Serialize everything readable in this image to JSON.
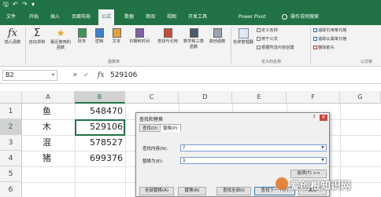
{
  "quick_access": {
    "save": "🖫",
    "undo": "↶",
    "redo": "↷",
    "more": "▾"
  },
  "tabs": [
    "文件",
    "开始",
    "插入",
    "页面布局",
    "公式",
    "数据",
    "审阅",
    "视图",
    "开发工具",
    "Power Pivot"
  ],
  "active_tab": "公式",
  "tell_me": "操作说明搜索",
  "ribbon": {
    "insert_function": "插入函数",
    "autosum": "自动求和",
    "recent": "最近使用的函数",
    "financial": "财务",
    "logical": "逻辑",
    "text": "文本",
    "datetime": "日期和时间",
    "lookup": "查找与引用",
    "math": "数学和三角函数",
    "more_functions": "其他函数",
    "function_library_label": "函数库",
    "name_manager": "名称管理器",
    "define_name": "定义名称",
    "use_in_formula": "用于公式",
    "create_from_selection": "根据所选内容创建",
    "defined_names_label": "定义的名称",
    "trace_precedents": "追踪引用单元格",
    "trace_dependents": "追踪从属单元格",
    "remove_arrows": "删除箭头",
    "formula_auditing_label": "公式审"
  },
  "formula_bar": {
    "name_box": "B2",
    "cancel": "✕",
    "enter": "✓",
    "fx": "fx",
    "value": "529106"
  },
  "columns": [
    "A",
    "B",
    "C",
    "D",
    "E",
    "F",
    "G"
  ],
  "rows": [
    {
      "num": "1",
      "a": "鱼",
      "b": "548470"
    },
    {
      "num": "2",
      "a": "木",
      "b": "529106"
    },
    {
      "num": "3",
      "a": "混",
      "b": "578527"
    },
    {
      "num": "4",
      "a": "猪",
      "b": "699376"
    },
    {
      "num": "5",
      "a": "",
      "b": ""
    },
    {
      "num": "6",
      "a": "",
      "b": ""
    }
  ],
  "dialog": {
    "title": "查找和替换",
    "help": "?",
    "close": "✕",
    "tab_find": "查找(D)",
    "tab_replace": "替换(P)",
    "find_label": "查找内容(N):",
    "find_value": "?",
    "replace_label": "替换为(E):",
    "replace_value": "1",
    "options": "选项(T) >>",
    "replace_all": "全部替换(A)",
    "replace": "替换(R)",
    "find_all": "查找全部(I)",
    "find_next": "查找下一个(F)",
    "close_btn": "关闭"
  },
  "watermark": "爱创根知识网"
}
